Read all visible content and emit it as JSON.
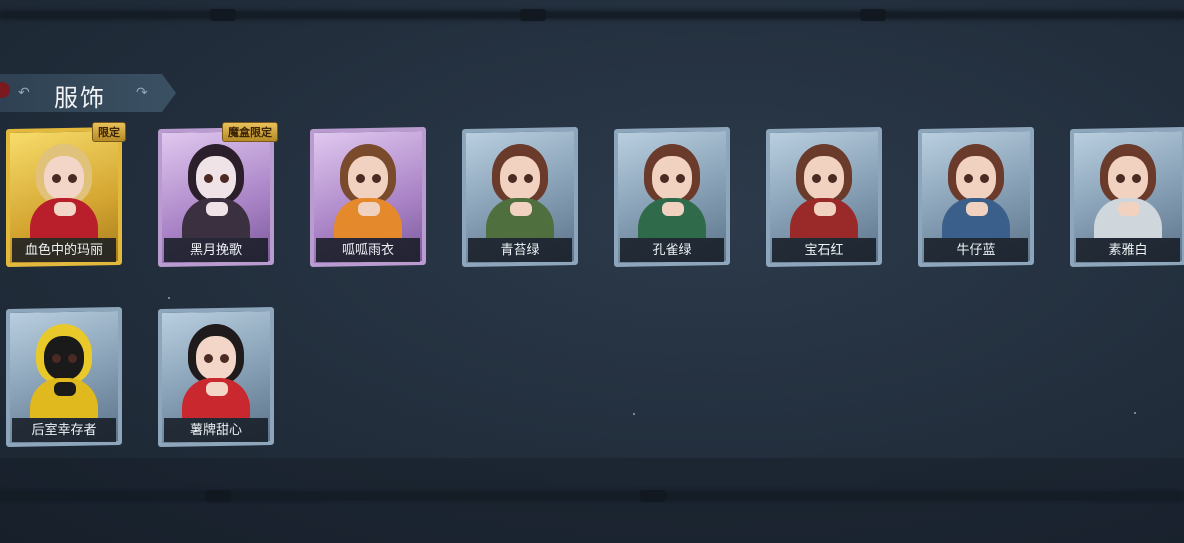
{
  "section": {
    "title": "服饰"
  },
  "colors": {
    "background": "#222e3c",
    "frame_default": "#8ea6bb",
    "frame_gold": "#e2b93c",
    "frame_purple": "#b99bd0",
    "label_bg": "#141a22",
    "label_text": "#eef2f5"
  },
  "costumes": [
    {
      "name": "血色中的玛丽",
      "badge": "限定",
      "frame": "gold",
      "hair": "#e0c27a",
      "outfit": "#b81f2a",
      "skin": "#f3d6c7"
    },
    {
      "name": "黑月挽歌",
      "badge": "魔盒限定",
      "frame": "purple",
      "hair": "#2a1f2b",
      "outfit": "#3a3040",
      "skin": "#efe3e8"
    },
    {
      "name": "呱呱雨衣",
      "badge": "",
      "frame": "purple",
      "hair": "#7a4a2c",
      "outfit": "#e58a2c",
      "skin": "#f1d2c0"
    },
    {
      "name": "青苔绿",
      "badge": "",
      "frame": "default",
      "hair": "#6a3a2a",
      "outfit": "#4f6f3f",
      "skin": "#f1d2c0"
    },
    {
      "name": "孔雀绿",
      "badge": "",
      "frame": "default",
      "hair": "#6a3a2a",
      "outfit": "#2f6b4a",
      "skin": "#f1d2c0"
    },
    {
      "name": "宝石红",
      "badge": "",
      "frame": "default",
      "hair": "#6a3a2a",
      "outfit": "#9a2a2a",
      "skin": "#f1d2c0"
    },
    {
      "name": "牛仔蓝",
      "badge": "",
      "frame": "default",
      "hair": "#6a3a2a",
      "outfit": "#3a5f8a",
      "skin": "#f1d2c0"
    },
    {
      "name": "素雅白",
      "badge": "",
      "frame": "default",
      "hair": "#6a3a2a",
      "outfit": "#cfd6dc",
      "skin": "#f1d2c0"
    },
    {
      "name": "后室幸存者",
      "badge": "",
      "frame": "default",
      "hair": "#e9c92a",
      "outfit": "#e0b91f",
      "skin": "#1a1a1a"
    },
    {
      "name": "薯牌甜心",
      "badge": "",
      "frame": "default",
      "hair": "#1f1a1c",
      "outfit": "#c8282e",
      "skin": "#f3d6c7"
    }
  ]
}
